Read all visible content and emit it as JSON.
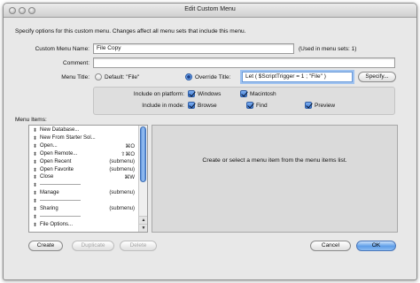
{
  "window": {
    "title": "Edit Custom Menu",
    "description": "Specify options for this custom menu.  Changes affect all menu sets that include this menu."
  },
  "custom_menu_name": {
    "label": "Custom Menu Name:",
    "value": "File Copy",
    "used_in": "(Used in menu sets: 1)"
  },
  "comment": {
    "label": "Comment:",
    "value": ""
  },
  "menu_title": {
    "label": "Menu Title:",
    "default_option": "Default: \"File\"",
    "override_option": "Override Title:",
    "selected": "override",
    "override_value": "Let ( $ScriptTrigger = 1 ; \"File\" )",
    "specify_button": "Specify..."
  },
  "include": {
    "platform_label": "Include on platform:",
    "mode_label": "Include in mode:",
    "platforms": [
      {
        "label": "Windows",
        "checked": true
      },
      {
        "label": "Macintosh",
        "checked": true
      }
    ],
    "modes": [
      {
        "label": "Browse",
        "checked": true
      },
      {
        "label": "Find",
        "checked": true
      },
      {
        "label": "Preview",
        "checked": true
      }
    ]
  },
  "menu_items": {
    "label": "Menu Items:",
    "items": [
      {
        "name": "New Database...",
        "shortcut": ""
      },
      {
        "name": "New From Starter Sol...",
        "shortcut": ""
      },
      {
        "name": "Open...",
        "shortcut": "⌘O"
      },
      {
        "name": "Open Remote...",
        "shortcut": "⇧⌘O"
      },
      {
        "name": "Open Recent",
        "shortcut": "(submenu)"
      },
      {
        "name": "Open Favorite",
        "shortcut": "(submenu)"
      },
      {
        "name": "Close",
        "shortcut": "⌘W"
      },
      {
        "name": "-----------------------",
        "shortcut": ""
      },
      {
        "name": "Manage",
        "shortcut": "(submenu)"
      },
      {
        "name": "-----------------------",
        "shortcut": ""
      },
      {
        "name": "Sharing",
        "shortcut": "(submenu)"
      },
      {
        "name": "-----------------------",
        "shortcut": ""
      },
      {
        "name": "File Options...",
        "shortcut": ""
      }
    ]
  },
  "detail_panel": {
    "message": "Create or select a menu item from the menu items list."
  },
  "buttons": {
    "create": "Create",
    "duplicate": "Duplicate",
    "delete": "Delete",
    "cancel": "Cancel",
    "ok": "OK"
  }
}
